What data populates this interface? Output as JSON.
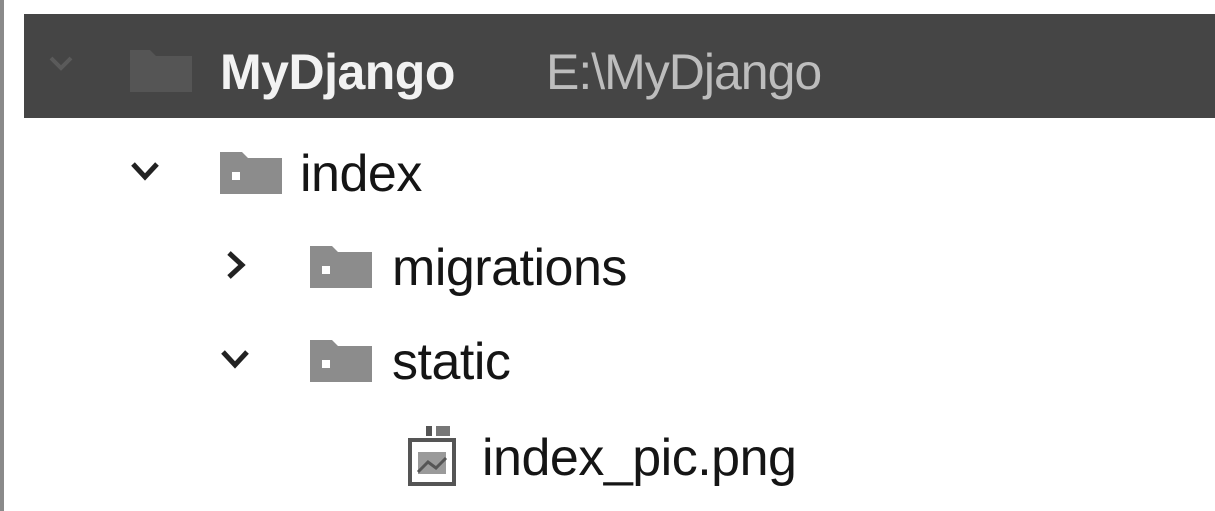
{
  "project": {
    "name": "MyDjango",
    "path": "E:\\MyDjango",
    "expanded": true
  },
  "tree": [
    {
      "label": "index",
      "kind": "folder",
      "expanded": true,
      "depth": 1
    },
    {
      "label": "migrations",
      "kind": "folder",
      "expanded": false,
      "depth": 2
    },
    {
      "label": "static",
      "kind": "folder",
      "expanded": true,
      "depth": 2
    },
    {
      "label": "index_pic.png",
      "kind": "image-file",
      "depth": 3
    }
  ],
  "colors": {
    "header_bg": "#454545",
    "folder": "#8c8c8c",
    "text": "#151515"
  }
}
